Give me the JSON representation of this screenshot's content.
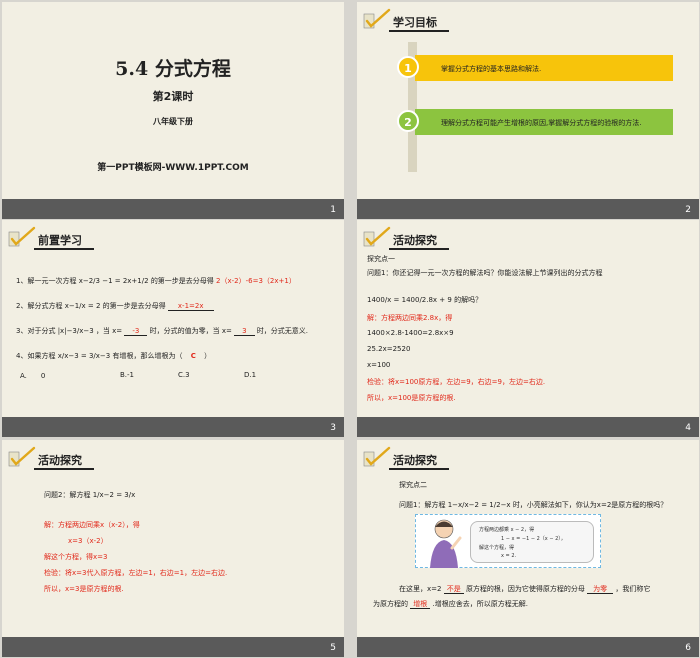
{
  "slides": [
    {
      "num": "1",
      "title": "5.4  分式方程",
      "subtitle": "第2课时",
      "grade": "八年级下册",
      "website": "第一PPT模板网-WWW.1PPT.COM"
    },
    {
      "num": "2",
      "left_mark": "",
      "header": "学习目标",
      "goals": [
        {
          "n": "1",
          "text": "掌握分式方程的基本思路和解法."
        },
        {
          "n": "2",
          "text": "理解分式方程可能产生增根的原因,掌握解分式方程的验根的方法."
        }
      ]
    },
    {
      "num": "3",
      "left_mark": "",
      "header": "前置学习",
      "q1_prefix": "1、解一元一次方程",
      "q1_eq": "x−2/3 −1 = 2x+1/2",
      "q1_mid": "的第一步是去分母得",
      "q1_ans": "2（x-2）-6=3（2x+1）",
      "q2_prefix": "2、解分式方程",
      "q2_eq": "x−1/x = 2",
      "q2_mid": "的第一步是去分母得",
      "q2_ans": "x-1=2x",
      "q3_prefix": "3、对于分式",
      "q3_eq": "|x|−3/x−3",
      "q3_mid1": "，当 x=",
      "q3_ans1": "-3",
      "q3_mid2": "时，分式的值为零，当 x=",
      "q3_ans2": "3",
      "q3_mid3": "时，分式无意义.",
      "q4_prefix": "4、如果方程",
      "q4_eq": "x/x−3 = 3/x−3",
      "q4_mid": "有增根，那么增根为（",
      "q4_ans": "C",
      "q4_end": "）",
      "options": [
        "A.　　0",
        "B.-1",
        "C.3",
        "D.1"
      ]
    },
    {
      "num": "4",
      "left_mark": "",
      "header": "活动探究",
      "lines": [
        {
          "text": "探究点一",
          "red": false
        },
        {
          "text": "问题1：你还记得一元一次方程的解法吗？你能设法解上节课列出的分式方程",
          "red": false
        },
        {
          "text": "1400/x = 1400/2.8x + 9 的解吗？",
          "red": false
        },
        {
          "text": "解：方程两边同乘2.8x，得",
          "red": true
        },
        {
          "text": "1400×2.8-1400=2.8x×9",
          "red": false
        },
        {
          "text": "25.2x=2520",
          "red": false
        },
        {
          "text": "x=100",
          "red": false
        },
        {
          "text": "检验：将x=100原方程，左边=9，右边=9，左边=右边.",
          "red": true
        },
        {
          "text": "所以，x=100是原方程的根.",
          "red": true
        }
      ]
    },
    {
      "num": "5",
      "left_mark": "",
      "header": "活动探究",
      "problem": "问题2：解方程",
      "eq": "1/x−2 = 3/x",
      "lines": [
        {
          "text": "解：方程两边同乘x（x-2），得",
          "red": true
        },
        {
          "text": "x=3（x-2）",
          "red": true
        },
        {
          "text": "解这个方程，得x=3",
          "red": true
        },
        {
          "text": "检验：将x=3代入原方程，左边=1，右边=1，左边=右边.",
          "red": true
        },
        {
          "text": "所以，x=3是原方程的根.",
          "red": true
        }
      ]
    },
    {
      "num": "6",
      "left_mark": "",
      "header": "活动探究",
      "point": "探究点二",
      "q_prefix": "问题1：解方程",
      "q_eq": "1−x/x−2 = 1/2−x",
      "q_mid": "时，小亮解法如下，你认为x=2是原方程的根吗？",
      "bubble": [
        "方程两边都乘 x − 2，得",
        "1 − x = −1 − 2（x − 2），",
        "解这个方程，得",
        "x = 2."
      ],
      "a1": "在这里，x=2",
      "a1_ans": "不是",
      "a1_mid": "原方程的根，因为它使得原方程的分母",
      "a1_ans2": "为零",
      "a1_end": "，我们称它",
      "a2": "为原方程的",
      "a2_ans": "增根",
      "a2_end": ".增根应舍去，所以原方程无解."
    }
  ],
  "colors": {
    "bg": "#f2efe3",
    "footer": "#5a5a5a",
    "goal1": "#f7c40b",
    "goal2": "#8cc43f",
    "red": "#e1281a"
  }
}
